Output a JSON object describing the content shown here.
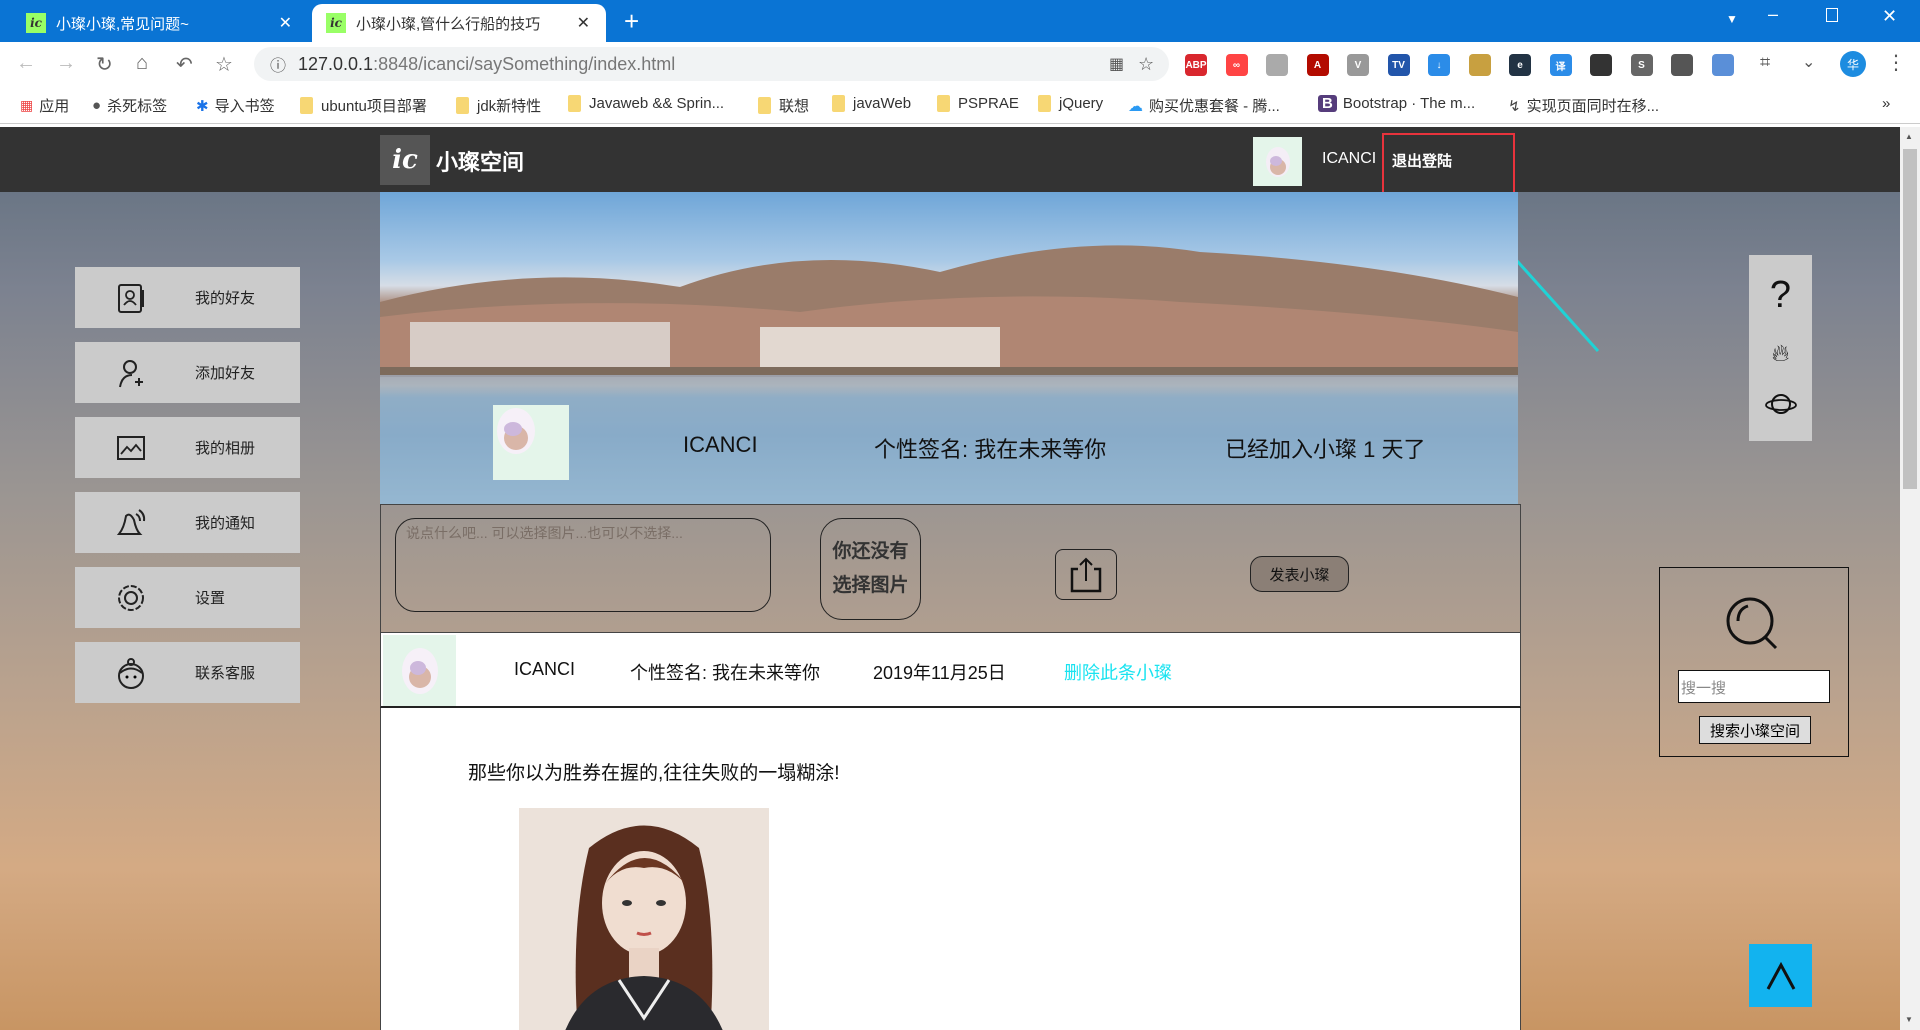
{
  "browser": {
    "tabs": [
      {
        "title": "小璨小璨,常见问题~",
        "active": false
      },
      {
        "title": "小璨小璨,管什么行船的技巧",
        "active": true
      }
    ],
    "favicon_text": "ic",
    "url_host": "127.0.0.1",
    "url_rest": ":8848/icanci/saySomething/index.html",
    "profile_initial": "华",
    "extensions": [
      {
        "label": "ABP",
        "color": "#d9272e"
      },
      {
        "label": "∞",
        "color": "#f44"
      },
      {
        "label": "",
        "color": "#aaa"
      },
      {
        "label": "A",
        "color": "#b30b00"
      },
      {
        "label": "V",
        "color": "#999"
      },
      {
        "label": "TV",
        "color": "#2255aa"
      },
      {
        "label": "↓",
        "color": "#2b8ce8"
      },
      {
        "label": "",
        "color": "#c8a040"
      },
      {
        "label": "e",
        "color": "#234"
      },
      {
        "label": "译",
        "color": "#2b8ce8"
      },
      {
        "label": "",
        "color": "#333"
      },
      {
        "label": "S",
        "color": "#666"
      },
      {
        "label": "",
        "color": "#555"
      },
      {
        "label": "",
        "color": "#5a8fd8"
      }
    ],
    "bookmarks": [
      "应用",
      "杀死标签",
      "导入书签",
      "ubuntu项目部署",
      "jdk新特性",
      "Javaweb && Sprin...",
      "联想",
      "javaWeb",
      "PSPRAE",
      "jQuery",
      "购买优惠套餐 - 腾...",
      "Bootstrap · The m...",
      "实现页面同时在移..."
    ],
    "more_bookmarks": "»"
  },
  "header": {
    "logo": "ic",
    "title": "小璨空间",
    "username": "ICANCI",
    "logout": "退出登陆"
  },
  "banner": {
    "username": "ICANCI",
    "signature": "个性签名: 我在未来等你",
    "joined": "已经加入小璨 1 天了"
  },
  "composer": {
    "placeholder": "说点什么吧... 可以选择图片...也可以不选择...",
    "no_image_line1": "你还没有",
    "no_image_line2": "选择图片",
    "post": "发表小璨"
  },
  "post": {
    "username": "ICANCI",
    "signature": "个性签名: 我在未来等你",
    "date": "2019年11月25日",
    "delete": "删除此条小璨",
    "text": "那些你以为胜券在握的,往往失败的一塌糊涂!"
  },
  "sidebar": [
    {
      "label": "我的好友",
      "icon": "contacts-icon"
    },
    {
      "label": "添加好友",
      "icon": "add-user-icon"
    },
    {
      "label": "我的相册",
      "icon": "album-icon"
    },
    {
      "label": "我的通知",
      "icon": "bell-icon"
    },
    {
      "label": "设置",
      "icon": "gear-icon"
    },
    {
      "label": "联系客服",
      "icon": "service-icon"
    }
  ],
  "search": {
    "placeholder": "搜一搜",
    "button": "搜索小璨空间"
  },
  "colors": {
    "accent": "#12b3ef",
    "delete_link": "#19e3f0",
    "highlight": "#e8333c",
    "tabbar": "#0a74d4"
  }
}
